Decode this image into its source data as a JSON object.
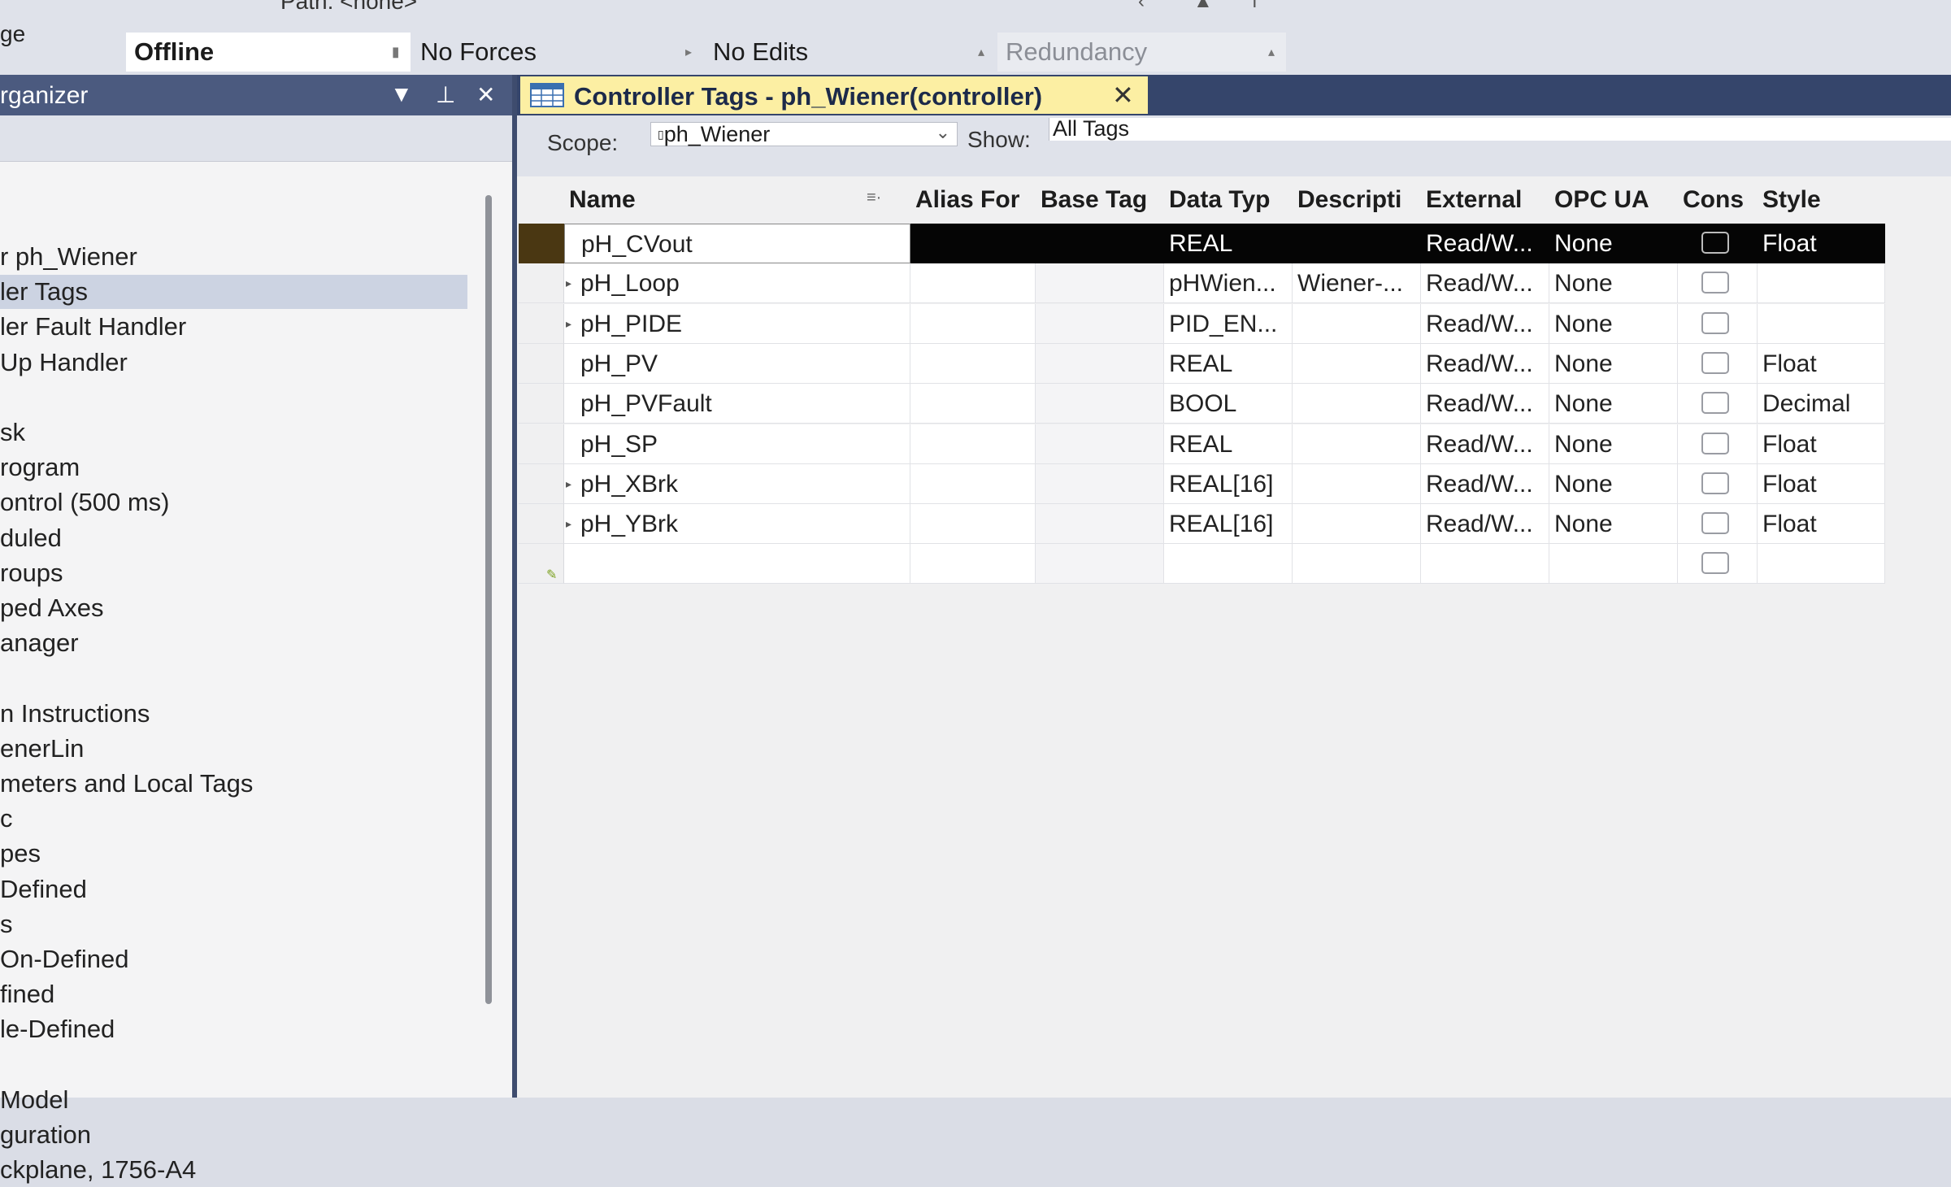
{
  "top": {
    "path_text": "Path: <none>",
    "left_crop_text": "ge",
    "status": {
      "mode": "Offline",
      "forces": "No Forces",
      "edits": "No Edits",
      "redundancy": "Redundancy"
    }
  },
  "organizer": {
    "title": "rganizer",
    "items": [
      {
        "label": "r ph_Wiener",
        "selected": false
      },
      {
        "label": "ler Tags",
        "selected": true
      },
      {
        "label": "ler Fault Handler",
        "selected": false
      },
      {
        "label": "Up Handler",
        "selected": false
      },
      {
        "label": "",
        "selected": false
      },
      {
        "label": "sk",
        "selected": false
      },
      {
        "label": "rogram",
        "selected": false
      },
      {
        "label": "ontrol (500 ms)",
        "selected": false
      },
      {
        "label": "duled",
        "selected": false
      },
      {
        "label": "roups",
        "selected": false
      },
      {
        "label": "ped Axes",
        "selected": false
      },
      {
        "label": "anager",
        "selected": false
      },
      {
        "label": "",
        "selected": false
      },
      {
        "label": "n Instructions",
        "selected": false
      },
      {
        "label": "enerLin",
        "selected": false
      },
      {
        "label": "meters and Local Tags",
        "selected": false
      },
      {
        "label": "c",
        "selected": false
      },
      {
        "label": "pes",
        "selected": false
      },
      {
        "label": "Defined",
        "selected": false
      },
      {
        "label": "s",
        "selected": false
      },
      {
        "label": "On-Defined",
        "selected": false
      },
      {
        "label": "fined",
        "selected": false
      },
      {
        "label": "le-Defined",
        "selected": false
      },
      {
        "label": "",
        "selected": false
      },
      {
        "label": "Model",
        "selected": false
      },
      {
        "label": "guration",
        "selected": false
      },
      {
        "label": "ckplane, 1756-A4",
        "selected": false
      }
    ]
  },
  "document": {
    "tab_title": "Controller Tags - ph_Wiener(controller)",
    "scope_label": "Scope:",
    "scope_value": "ph_Wiener",
    "show_label": "Show:",
    "show_value": "All Tags",
    "columns": [
      "Name",
      "Alias For",
      "Base Tag",
      "Data Typ",
      "Descripti",
      "External",
      "OPC UA",
      "Cons",
      "Style"
    ],
    "rows": [
      {
        "name": "pH_CVout",
        "expandable": false,
        "alias": "",
        "base": "",
        "type": "REAL",
        "desc": "",
        "external": "Read/W...",
        "opc": "None",
        "style": "Float",
        "selected": true
      },
      {
        "name": "pH_Loop",
        "expandable": true,
        "alias": "",
        "base": "",
        "type": "pHWien...",
        "desc": "Wiener-...",
        "external": "Read/W...",
        "opc": "None",
        "style": "",
        "selected": false
      },
      {
        "name": "pH_PIDE",
        "expandable": true,
        "alias": "",
        "base": "",
        "type": "PID_EN...",
        "desc": "",
        "external": "Read/W...",
        "opc": "None",
        "style": "",
        "selected": false
      },
      {
        "name": "pH_PV",
        "expandable": false,
        "alias": "",
        "base": "",
        "type": "REAL",
        "desc": "",
        "external": "Read/W...",
        "opc": "None",
        "style": "Float",
        "selected": false
      },
      {
        "name": "pH_PVFault",
        "expandable": false,
        "alias": "",
        "base": "",
        "type": "BOOL",
        "desc": "",
        "external": "Read/W...",
        "opc": "None",
        "style": "Decimal",
        "selected": false
      },
      {
        "name": "pH_SP",
        "expandable": false,
        "alias": "",
        "base": "",
        "type": "REAL",
        "desc": "",
        "external": "Read/W...",
        "opc": "None",
        "style": "Float",
        "selected": false
      },
      {
        "name": "pH_XBrk",
        "expandable": true,
        "alias": "",
        "base": "",
        "type": "REAL[16]",
        "desc": "",
        "external": "Read/W...",
        "opc": "None",
        "style": "Float",
        "selected": false
      },
      {
        "name": "pH_YBrk",
        "expandable": true,
        "alias": "",
        "base": "",
        "type": "REAL[16]",
        "desc": "",
        "external": "Read/W...",
        "opc": "None",
        "style": "Float",
        "selected": false
      }
    ]
  },
  "colors": {
    "organizer_header": "#4b5a7f",
    "tab_active": "#fcefa3",
    "selection_row": "#050505"
  }
}
